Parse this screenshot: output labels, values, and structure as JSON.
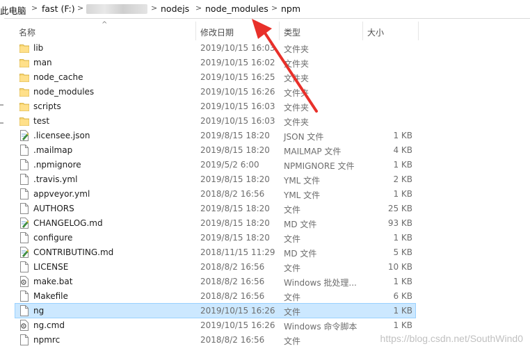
{
  "breadcrumb": {
    "items": [
      "此电脑",
      "fast (F:)",
      "",
      "nodejs",
      "node_modules",
      "npm"
    ]
  },
  "columns": {
    "name": "名称",
    "date": "修改日期",
    "type": "类型",
    "size": "大小"
  },
  "files": [
    {
      "name": "lib",
      "date": "2019/10/15 16:03",
      "type": "文件夹",
      "size": "",
      "icon": "folder-icon"
    },
    {
      "name": "man",
      "date": "2019/10/15 16:02",
      "type": "文件夹",
      "size": "",
      "icon": "folder-icon"
    },
    {
      "name": "node_cache",
      "date": "2019/10/15 16:25",
      "type": "文件夹",
      "size": "",
      "icon": "folder-icon"
    },
    {
      "name": "node_modules",
      "date": "2019/10/15 16:26",
      "type": "文件夹",
      "size": "",
      "icon": "folder-icon"
    },
    {
      "name": "scripts",
      "date": "2019/10/15 16:03",
      "type": "文件夹",
      "size": "",
      "icon": "folder-icon"
    },
    {
      "name": "test",
      "date": "2019/10/15 16:03",
      "type": "文件夹",
      "size": "",
      "icon": "folder-icon"
    },
    {
      "name": ".licensee.json",
      "date": "2019/8/15 18:20",
      "type": "JSON 文件",
      "size": "1 KB",
      "icon": "edit-file-icon"
    },
    {
      "name": ".mailmap",
      "date": "2019/8/15 18:20",
      "type": "MAILMAP 文件",
      "size": "4 KB",
      "icon": "file-icon"
    },
    {
      "name": ".npmignore",
      "date": "2019/5/2 6:00",
      "type": "NPMIGNORE 文件",
      "size": "1 KB",
      "icon": "file-icon"
    },
    {
      "name": ".travis.yml",
      "date": "2019/8/15 18:20",
      "type": "YML 文件",
      "size": "2 KB",
      "icon": "file-icon"
    },
    {
      "name": "appveyor.yml",
      "date": "2018/8/2 16:56",
      "type": "YML 文件",
      "size": "1 KB",
      "icon": "file-icon"
    },
    {
      "name": "AUTHORS",
      "date": "2019/8/15 18:20",
      "type": "文件",
      "size": "25 KB",
      "icon": "file-icon"
    },
    {
      "name": "CHANGELOG.md",
      "date": "2019/8/15 18:20",
      "type": "MD 文件",
      "size": "93 KB",
      "icon": "edit-file-icon"
    },
    {
      "name": "configure",
      "date": "2019/8/15 18:20",
      "type": "文件",
      "size": "1 KB",
      "icon": "file-icon"
    },
    {
      "name": "CONTRIBUTING.md",
      "date": "2018/11/15 11:29",
      "type": "MD 文件",
      "size": "5 KB",
      "icon": "edit-file-icon"
    },
    {
      "name": "LICENSE",
      "date": "2018/8/2 16:56",
      "type": "文件",
      "size": "10 KB",
      "icon": "file-icon"
    },
    {
      "name": "make.bat",
      "date": "2018/8/2 16:56",
      "type": "Windows 批处理...",
      "size": "1 KB",
      "icon": "batch-file-icon"
    },
    {
      "name": "Makefile",
      "date": "2018/8/2 16:56",
      "type": "文件",
      "size": "6 KB",
      "icon": "file-icon"
    },
    {
      "name": "ng",
      "date": "2019/10/15 16:26",
      "type": "文件",
      "size": "1 KB",
      "icon": "file-icon",
      "selected": true
    },
    {
      "name": "ng.cmd",
      "date": "2019/10/15 16:26",
      "type": "Windows 命令脚本",
      "size": "1 KB",
      "icon": "batch-file-icon"
    },
    {
      "name": "npmrc",
      "date": "2018/8/2 16:56",
      "type": "文件",
      "size": "",
      "icon": "file-icon"
    }
  ],
  "watermark": "https://blog.csdn.net/SouthWind0",
  "colors": {
    "selection": "#cce8ff",
    "selection_border": "#99d1ff",
    "folder": "#f8d775",
    "arrow": "#e8302a"
  }
}
